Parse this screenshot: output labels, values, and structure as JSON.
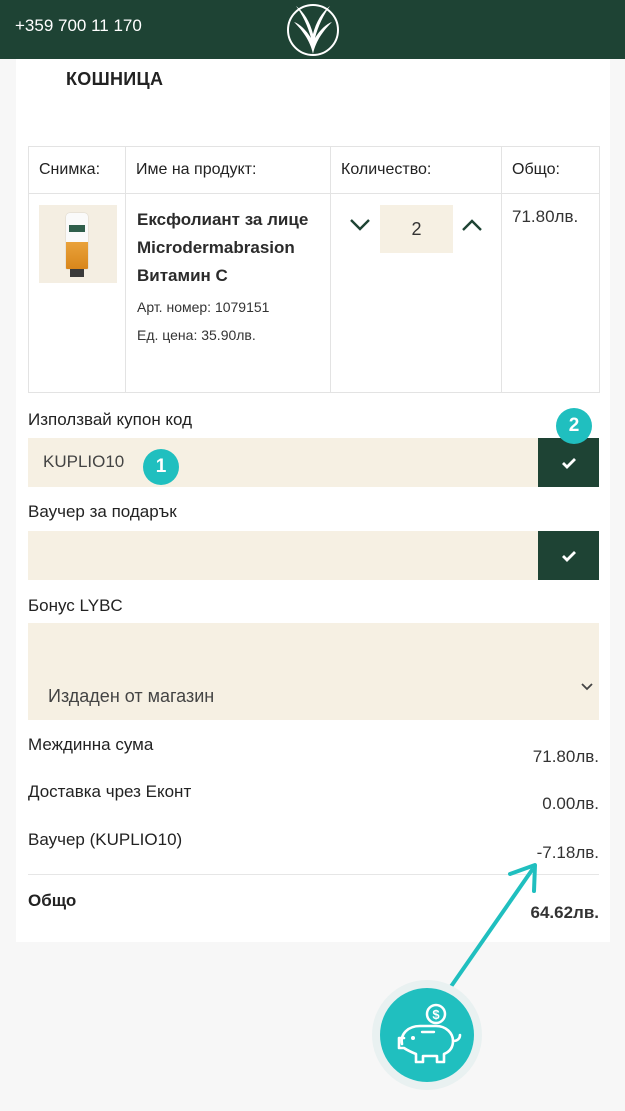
{
  "header": {
    "phone": "+359 700 11 170",
    "logo_icon": "fern-leaf-logo-icon",
    "background": "#1e4334"
  },
  "cart": {
    "title": "КОШНИЦА",
    "columns": [
      "Снимка:",
      "Име на продукт:",
      "Количество:",
      "Общо:"
    ],
    "product": {
      "name": "Ексфолиант за лице Microdermabrasion Витамин С",
      "sku": "Арт. номер: 1079151",
      "unit_price": "Ед. цена: 35.90лв.",
      "quantity": "2",
      "total": "71.80лв."
    }
  },
  "coupon": {
    "label": "Използвай купон код",
    "value": "KUPLIO10",
    "apply_icon": "checkmark-icon"
  },
  "voucher": {
    "label": "Ваучер за подарък",
    "value": "",
    "apply_icon": "checkmark-icon"
  },
  "bonus": {
    "label": "Бонус LYBC",
    "selected": "Издаден от магазин"
  },
  "summary": {
    "subtotal_label": "Междинна сума",
    "subtotal_value": "71.80лв.",
    "delivery_label": "Доставка чрез Еконт",
    "delivery_value": "0.00лв.",
    "voucher_label": "Ваучер (KUPLIO10)",
    "voucher_value": "-7.18лв.",
    "total_label": "Общо",
    "total_value": "64.62лв."
  },
  "annotations": {
    "step1": "1",
    "step2": "2",
    "accent": "#20bfbf",
    "piggy_icon": "piggy-bank-icon"
  }
}
